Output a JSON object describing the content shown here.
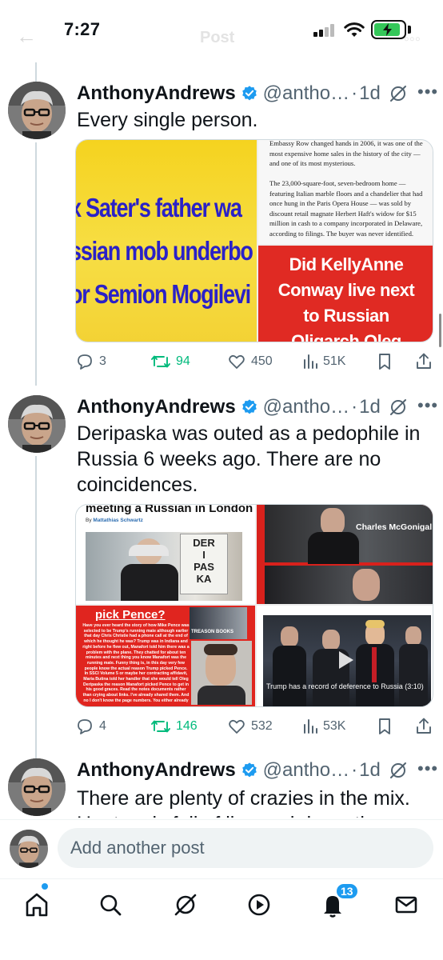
{
  "status_bar": {
    "time": "7:27"
  },
  "header": {
    "title": "Post"
  },
  "accent": "#1d9bf0",
  "tweets": [
    {
      "name": "AnthonyAndrews",
      "handle": "@antho…",
      "time": "1d",
      "text": "Every single person.",
      "media": {
        "left_image_text": [
          "x Sater's father wa",
          "ssian mob underbo",
          "or Semion Mogilevi"
        ],
        "article_text": "Embassy Row changed hands in 2006, it was one of the most expensive home sales in the history of the city — and one of its most mysterious.\n\nThe 23,000-square-foot, seven-bedroom home — featuring Italian marble floors and a chandelier that had once hung in the Paris Opera House — was sold by discount retail magnate Herbert Haft's widow for $15 million in cash to a company incorporated in Delaware, according to filings. The buyer was never identified.",
        "red_image_text": [
          "Did KellyAnne",
          "Conway live next",
          "to Russian",
          "Oligarch Oleg"
        ]
      },
      "stats": {
        "replies": "3",
        "reposts": "94",
        "likes": "450",
        "views": "51K"
      }
    },
    {
      "name": "AnthonyAndrews",
      "handle": "@antho…",
      "time": "1d",
      "text": "Deripaska was outed as a pedophile in Russia 6 weeks ago. There are no coincidences.",
      "media": {
        "article_headline": "meeting a Russian in London",
        "article_byline_prefix": "By",
        "article_byline_author": "Mattathias Schwartz",
        "protest_sign": [
          "DER",
          "I",
          "PAS",
          "KA"
        ],
        "photo_caption": "Charles McGonigal",
        "red_headline": "pick Pence?",
        "red_body": "Have you ever heard the story of how Mike Pence was selected to be Trump's running mate although earlier that day Chris Christie had a phone call at the end of which he thought he was? Trump was in Indiana and right before he flew out, Manafort told him there was a problem with the plane. They chatted for about ten minutes and next thing you know Manafort was the running mate. Funny thing is, in this day very few people know the actual reason Trump picked Pence. In SSCI Volume 5 or maybe her contracting affidavit, Maria Butina told her handler that she would tell Oleg Deripaska the reason Manafort picked Pence to get in his good graces. Read the notes documents rather than crying about links. I've already shared them. And no I don't know the page numbers. You either already",
        "inset_label": "TREASON BOOKS",
        "video_caption": "Trump has a record of deference to Russia (3:10)"
      },
      "stats": {
        "replies": "4",
        "reposts": "146",
        "likes": "532",
        "views": "53K"
      }
    },
    {
      "name": "AnthonyAndrews",
      "handle": "@antho…",
      "time": "1d",
      "text": "There are plenty of crazies in the mix.",
      "text_cut": "He, too, is full of lies and deception."
    }
  ],
  "composer": {
    "placeholder": "Add another post"
  },
  "tabbar": {
    "notifications_badge": "13"
  },
  "icons": {
    "verified": "verified-badge-icon",
    "grok": "grok-icon",
    "more": "more-icon",
    "reply": "reply-icon",
    "repost": "repost-icon",
    "like": "heart-icon",
    "views": "views-icon",
    "bookmark": "bookmark-icon",
    "share": "share-icon"
  }
}
